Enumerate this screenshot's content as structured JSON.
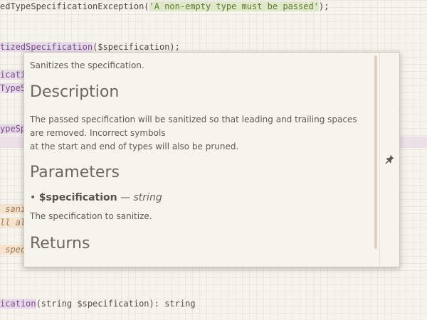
{
  "editor": {
    "line1": {
      "prefix": "edTypeSpecificationException(",
      "string": "'A non-empty type must be passed'",
      "suffix": ");"
    },
    "line2": {
      "method": "tizedSpecification",
      "suffix": "($specification);"
    },
    "fragments": {
      "f1": "icati",
      "f2": "TypeS",
      "f3": "ypeSp",
      "f4": " sani",
      "f5": "ll al",
      "f6": " spec"
    },
    "line_bottom": {
      "method": "ication",
      "suffix": "(string $specification): string"
    }
  },
  "popup": {
    "summary": "Sanitizes the specification.",
    "description_heading": "Description",
    "description_lines": [
      "The passed specification will be sanitized so that leading and trailing spaces are removed. Incorrect symbols",
      "at the start and end of types will also be pruned."
    ],
    "parameters_heading": "Parameters",
    "parameter": {
      "bullet": "•",
      "name": "$specification",
      "dash": "—",
      "type": "string",
      "description": "The specification to sanitize."
    },
    "returns_heading": "Returns",
    "pin_icon": "pin-icon"
  }
}
